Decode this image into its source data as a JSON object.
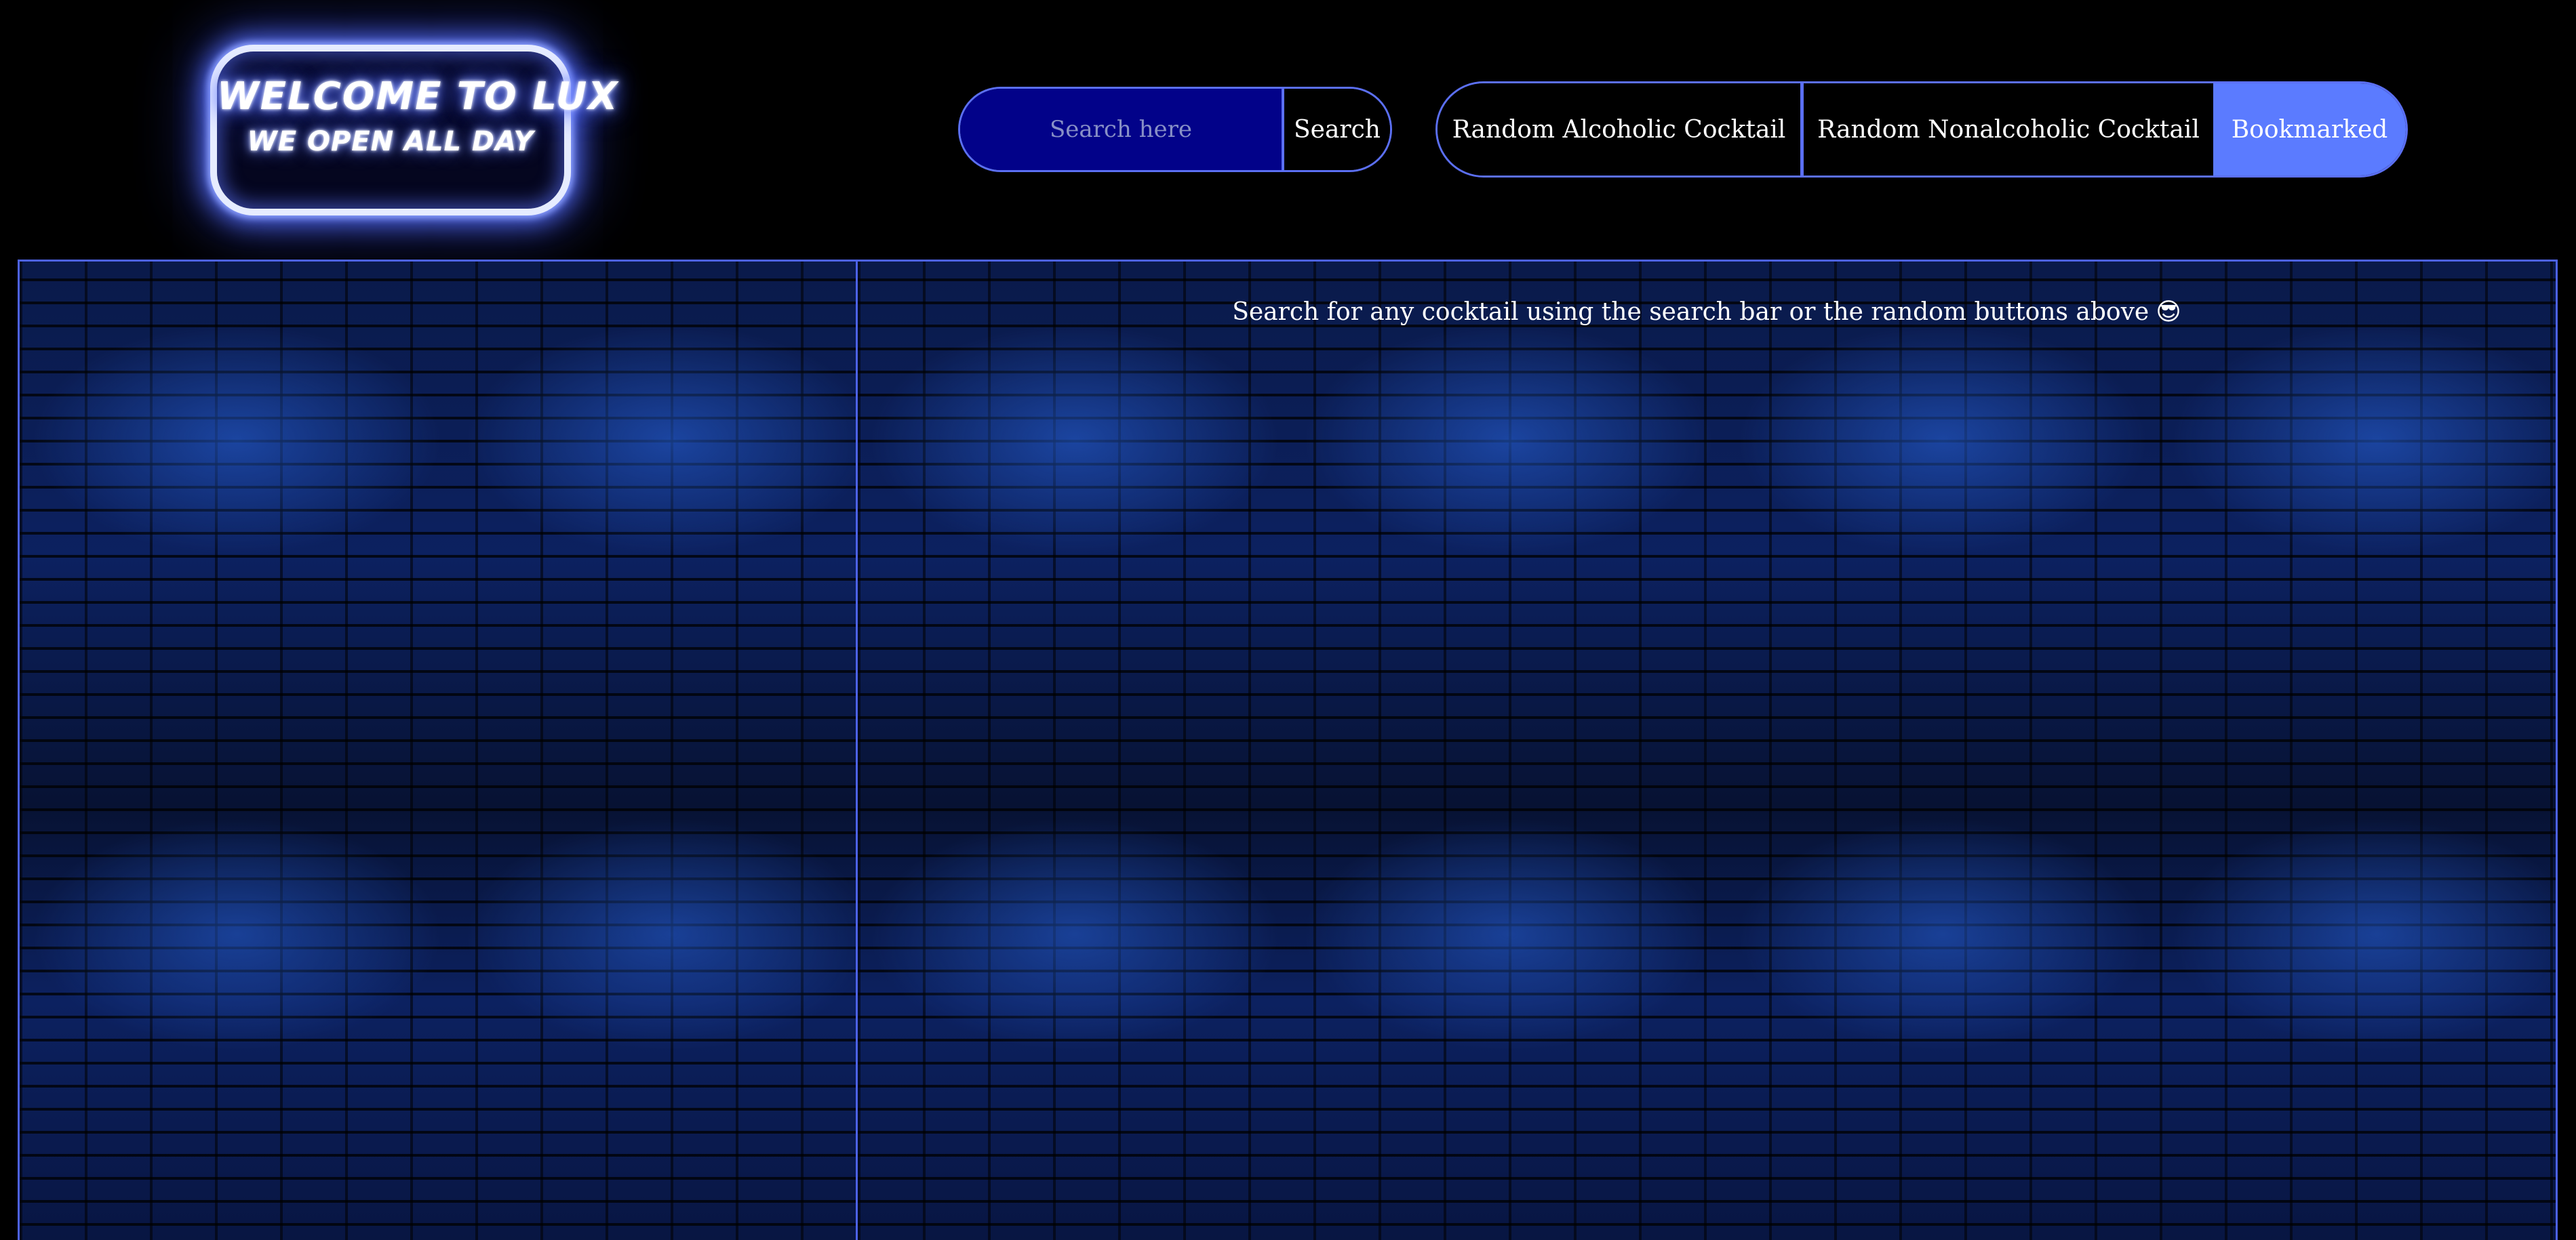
{
  "sign": {
    "line1": "WELCOME TO LUX",
    "line2": "WE OPEN ALL DAY"
  },
  "search": {
    "placeholder": "Search here",
    "value": "",
    "button_label": "Search"
  },
  "buttons": {
    "random_alcoholic": "Random Alcoholic Cocktail",
    "random_nonalcoholic": "Random Nonalcoholic Cocktail",
    "bookmarked": "Bookmarked"
  },
  "main": {
    "message": "Search for any cocktail using the search bar or the random buttons above",
    "message_icon": "😎"
  },
  "colors": {
    "accent": "#5b6ff2",
    "bookmarked_bg": "#5b7bff",
    "search_bg": "#020289",
    "page_bg": "#000000"
  },
  "icons": {
    "message_icon": "sunglasses-emoji-icon"
  }
}
